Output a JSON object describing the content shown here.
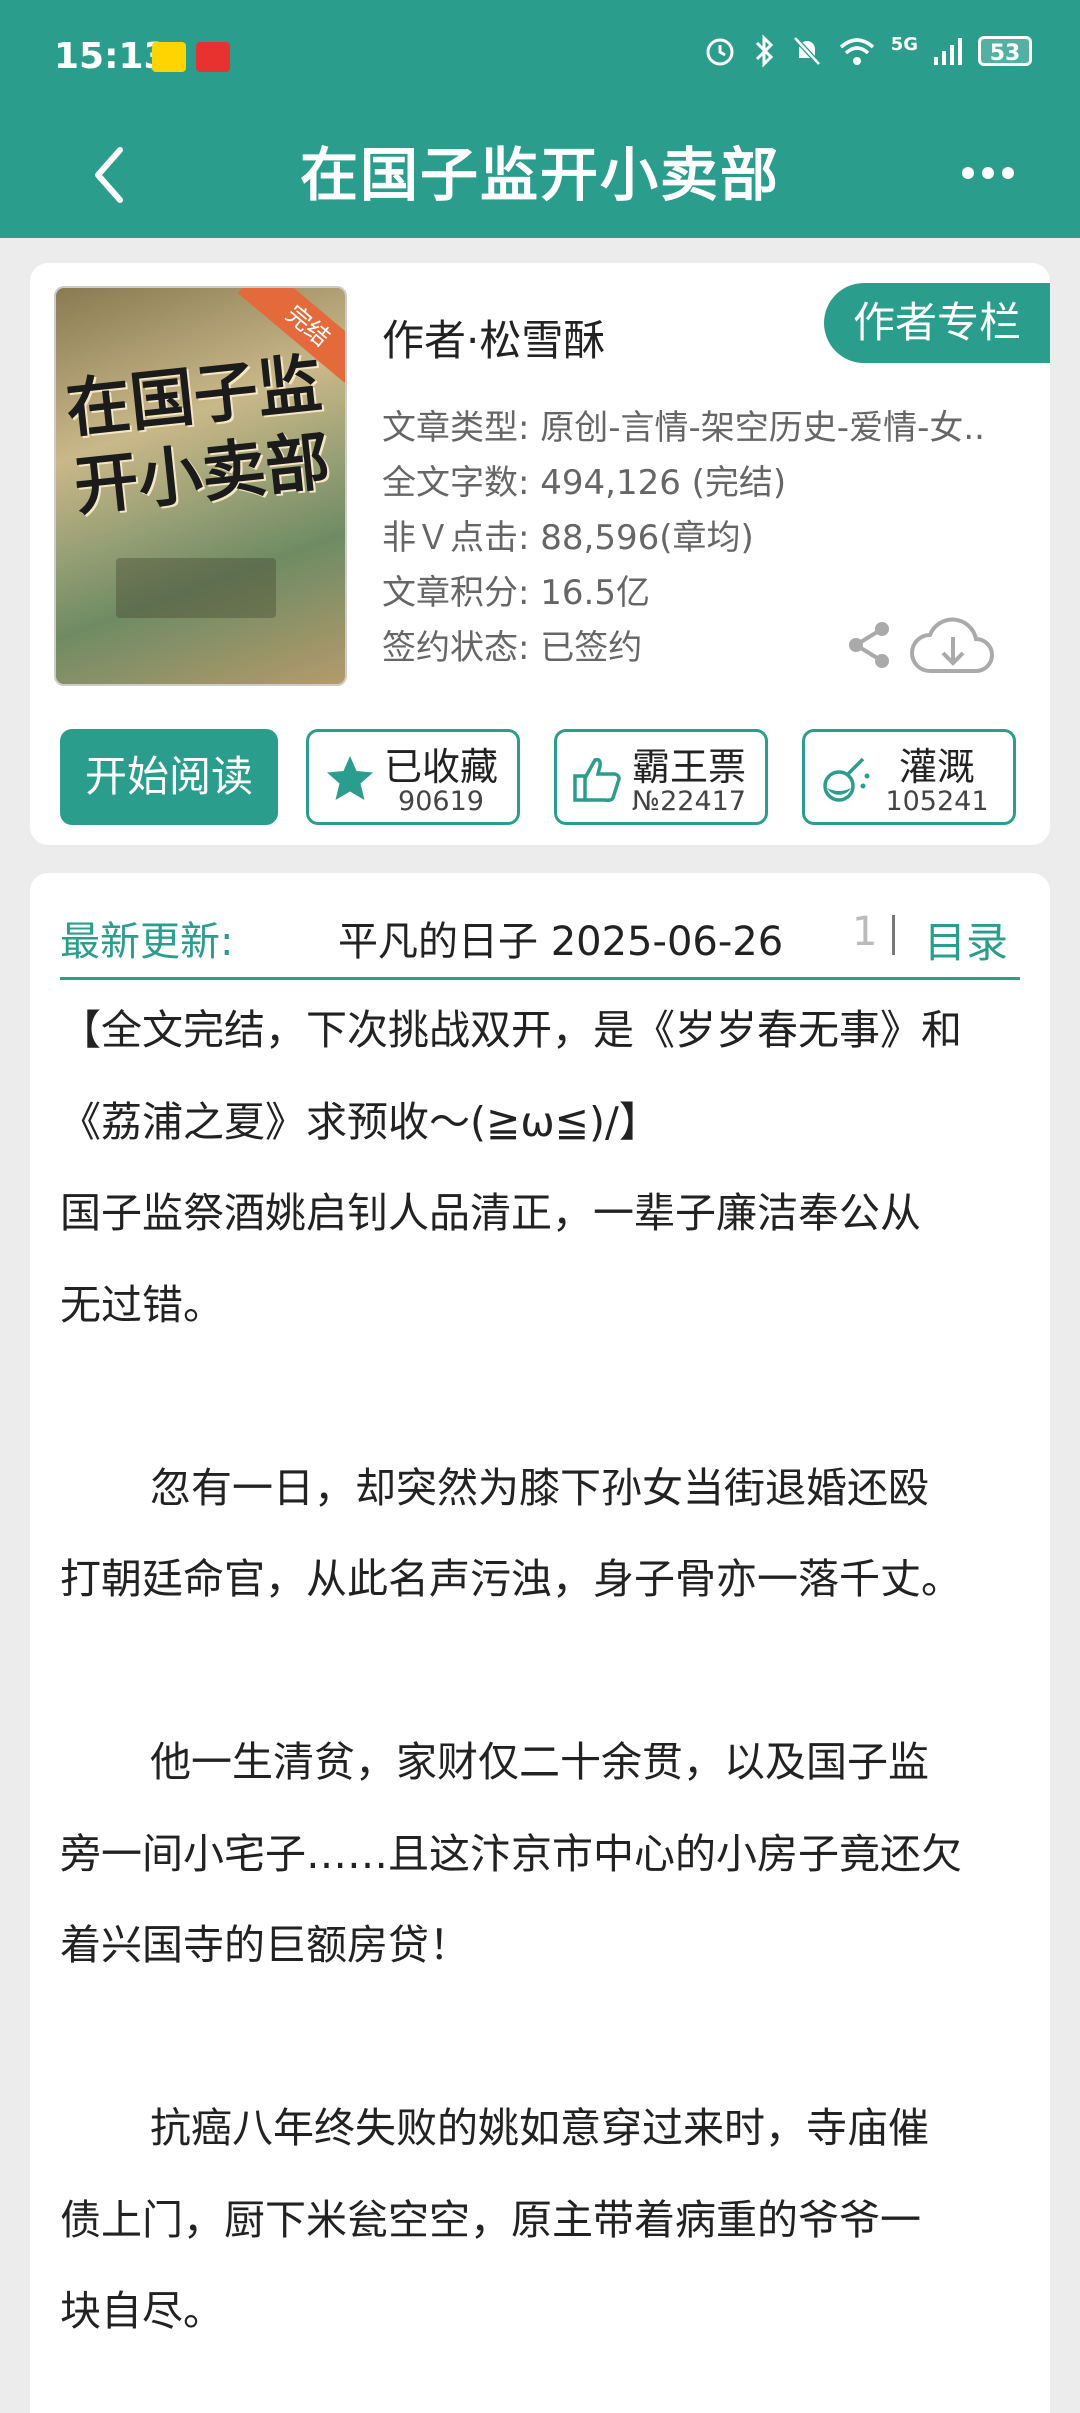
{
  "status": {
    "time": "15:13",
    "network": "5G",
    "battery": "53"
  },
  "header": {
    "title": "在国子监开小卖部"
  },
  "book": {
    "cover_title": "在国子监开小卖部",
    "cover_badge": "完结",
    "author": "作者·松雪酥",
    "author_column_label": "作者专栏",
    "meta": [
      "文章类型: 原创-言情-架空历史-爱情-女..",
      "全文字数: 494,126 (完结)",
      "非Ｖ点击: 88,596(章均)",
      "文章积分: 16.5亿",
      "签约状态: 已签约"
    ]
  },
  "actions": {
    "start_label": "开始阅读",
    "collect": {
      "label": "已收藏",
      "count": "90619"
    },
    "ticket": {
      "label": "霸王票",
      "count": "№22417"
    },
    "nutrient": {
      "label": "灌溉",
      "count": "105241"
    }
  },
  "update": {
    "label": "最新更新:",
    "value": "平凡的日子  2025-06-26",
    "cut": "1",
    "toc_label": "目录"
  },
  "intro": {
    "lines": [
      "【全文完结，下次挑战双开，是《岁岁春无事》和",
      "《荔浦之夏》求预收～(≧ω≦)/】",
      "国子监祭酒姚启钊人品清正，一辈子廉洁奉公从",
      "无过错。",
      "忽有一日，却突然为膝下孙女当街退婚还殴",
      "打朝廷命官，从此名声污浊，身子骨亦一落千丈。",
      "他一生清贫，家财仅二十余贯，以及国子监",
      "旁一间小宅子……且这汴京市中心的小房子竟还欠",
      "着兴国寺的巨额房贷！",
      "抗癌八年终失败的姚如意穿过来时，寺庙催",
      "债上门，厨下米瓮空空，原主带着病重的爷爷一",
      "块自尽。"
    ]
  },
  "colors": {
    "accent": "#2a9d8c",
    "background": "#ececec"
  }
}
